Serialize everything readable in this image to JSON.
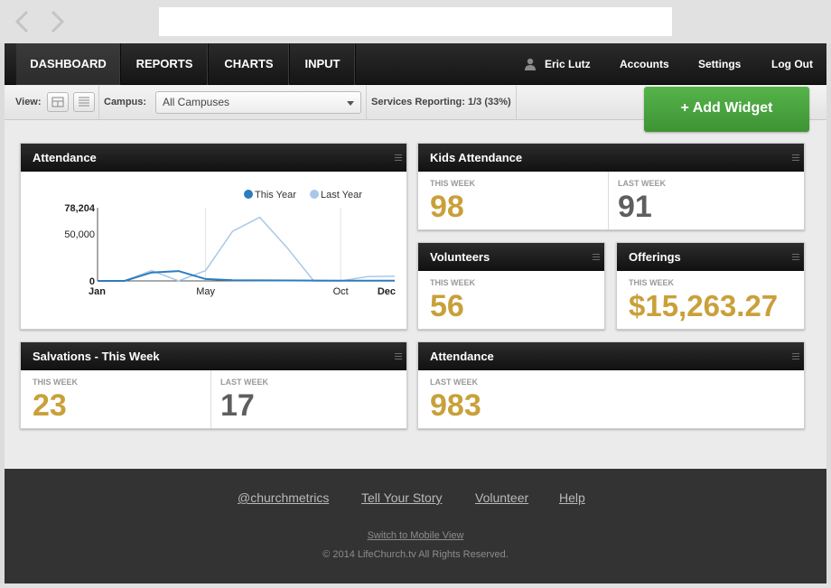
{
  "nav": {
    "tabs": [
      {
        "label": "DASHBOARD"
      },
      {
        "label": "REPORTS"
      },
      {
        "label": "CHARTS"
      },
      {
        "label": "INPUT"
      }
    ],
    "user_name": "Eric Lutz",
    "accounts": "Accounts",
    "settings": "Settings",
    "logout": "Log Out"
  },
  "toolbar": {
    "view_label": "View:",
    "campus_label": "Campus:",
    "campus_value": "All Campuses",
    "services_reporting": "Services Reporting: 1/3 (33%)",
    "add_widget": "+ Add Widget"
  },
  "widgets": {
    "attendance_chart": {
      "title": "Attendance"
    },
    "kids": {
      "title": "Kids Attendance",
      "this_week_label": "THIS WEEK",
      "this_week": "98",
      "last_week_label": "LAST WEEK",
      "last_week": "91"
    },
    "volunteers": {
      "title": "Volunteers",
      "this_week_label": "THIS WEEK",
      "this_week": "56"
    },
    "offerings": {
      "title": "Offerings",
      "this_week_label": "THIS WEEK",
      "this_week": "$15,263.27"
    },
    "salvations": {
      "title": "Salvations - This Week",
      "this_week_label": "THIS WEEK",
      "this_week": "23",
      "last_week_label": "LAST WEEK",
      "last_week": "17"
    },
    "attendance": {
      "title": "Attendance",
      "last_week_label": "LAST WEEK",
      "last_week": "983"
    }
  },
  "colors": {
    "accent_green": "#4caf43",
    "gold": "#c9a03a",
    "this_year": "#2d7bc0",
    "last_year": "#a9c8e8"
  },
  "chart_data": {
    "type": "line",
    "title": "",
    "xlabel": "",
    "ylabel": "",
    "x_ticks": [
      "Jan",
      "May",
      "Oct",
      "Dec"
    ],
    "y_ticks": [
      "0",
      "50,000",
      "78,204"
    ],
    "ylim": [
      0,
      78204
    ],
    "legend": "top-right",
    "series": [
      {
        "name": "This Year",
        "color": "#2d7bc0",
        "x": [
          0,
          1,
          2,
          3,
          4,
          5,
          6,
          7,
          8,
          9,
          10,
          11
        ],
        "values": [
          0,
          0,
          9000,
          10500,
          2000,
          800,
          600,
          500,
          400,
          300,
          300,
          300
        ]
      },
      {
        "name": "Last Year",
        "color": "#a9c8e8",
        "x": [
          0,
          1,
          2,
          3,
          4,
          5,
          6,
          7,
          8,
          9,
          10,
          11
        ],
        "values": [
          0,
          0,
          11000,
          0,
          11000,
          53000,
          68000,
          36000,
          0,
          0,
          4500,
          5000
        ]
      }
    ]
  },
  "footer": {
    "links": [
      "@churchmetrics",
      "Tell Your Story",
      "Volunteer",
      "Help"
    ],
    "mobile": "Switch to Mobile View",
    "copyright": "© 2014 LifeChurch.tv All Rights Reserved."
  }
}
